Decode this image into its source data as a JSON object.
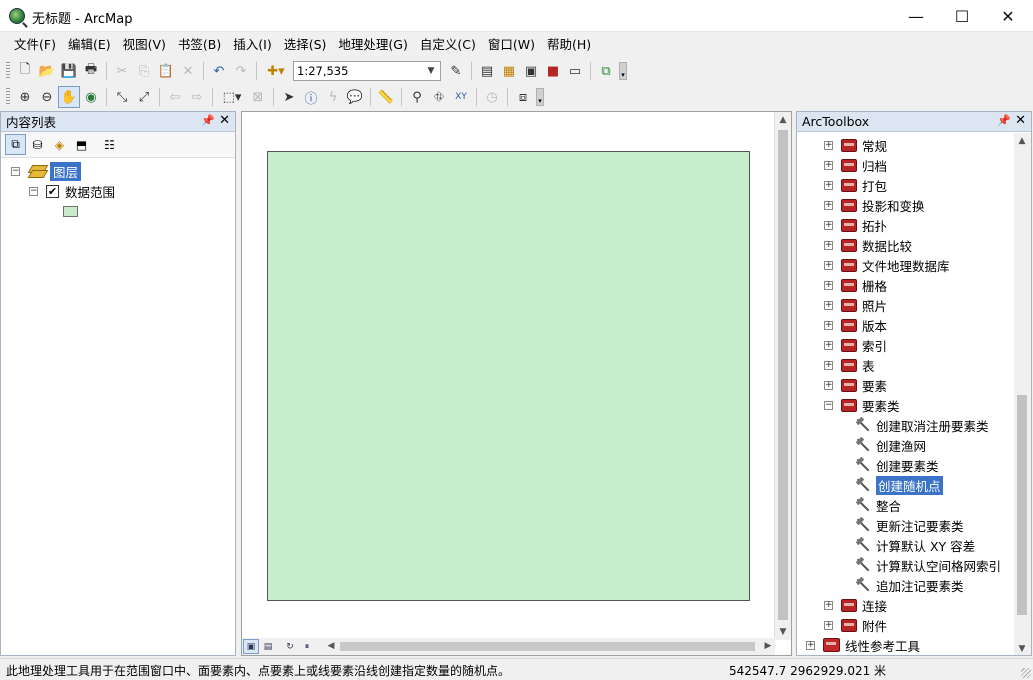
{
  "window": {
    "title": "无标题 - ArcMap",
    "minimize": "—",
    "maximize": "☐",
    "close": "✕"
  },
  "menu": [
    "文件(F)",
    "编辑(E)",
    "视图(V)",
    "书签(B)",
    "插入(I)",
    "选择(S)",
    "地理处理(G)",
    "自定义(C)",
    "窗口(W)",
    "帮助(H)"
  ],
  "toolbar": {
    "scale": "1:27,535"
  },
  "toc": {
    "title": "内容列表",
    "root_label": "图层",
    "layer_label": "数据范围",
    "layer_checked": true,
    "layer_symbol_color": "#c6eccb"
  },
  "map": {
    "polygon_fill": "#c6eecc"
  },
  "toolbox": {
    "title": "ArcToolbox",
    "items": [
      {
        "label": "常规",
        "type": "toolset",
        "expanded": false
      },
      {
        "label": "归档",
        "type": "toolset",
        "expanded": false
      },
      {
        "label": "打包",
        "type": "toolset",
        "expanded": false
      },
      {
        "label": "投影和变换",
        "type": "toolset",
        "expanded": false
      },
      {
        "label": "拓扑",
        "type": "toolset",
        "expanded": false
      },
      {
        "label": "数据比较",
        "type": "toolset",
        "expanded": false
      },
      {
        "label": "文件地理数据库",
        "type": "toolset",
        "expanded": false
      },
      {
        "label": "栅格",
        "type": "toolset",
        "expanded": false
      },
      {
        "label": "照片",
        "type": "toolset",
        "expanded": false
      },
      {
        "label": "版本",
        "type": "toolset",
        "expanded": false
      },
      {
        "label": "索引",
        "type": "toolset",
        "expanded": false
      },
      {
        "label": "表",
        "type": "toolset",
        "expanded": false
      },
      {
        "label": "要素",
        "type": "toolset",
        "expanded": false
      },
      {
        "label": "要素类",
        "type": "toolset",
        "expanded": true
      },
      {
        "label": "创建取消注册要素类",
        "type": "tool"
      },
      {
        "label": "创建渔网",
        "type": "tool"
      },
      {
        "label": "创建要素类",
        "type": "tool"
      },
      {
        "label": "创建随机点",
        "type": "tool",
        "selected": true
      },
      {
        "label": "整合",
        "type": "tool"
      },
      {
        "label": "更新注记要素类",
        "type": "tool"
      },
      {
        "label": "计算默认 XY 容差",
        "type": "tool"
      },
      {
        "label": "计算默认空间格网索引",
        "type": "tool"
      },
      {
        "label": "追加注记要素类",
        "type": "tool"
      },
      {
        "label": "连接",
        "type": "toolset",
        "expanded": false
      },
      {
        "label": "附件",
        "type": "toolset",
        "expanded": false
      },
      {
        "label": "线性参考工具",
        "type": "toolbox",
        "expanded": false
      }
    ]
  },
  "status": {
    "message": "此地理处理工具用于在范围窗口中、面要素内、点要素上或线要素沿线创建指定数量的随机点。",
    "coordinates": "542547.7  2962929.021 米"
  }
}
